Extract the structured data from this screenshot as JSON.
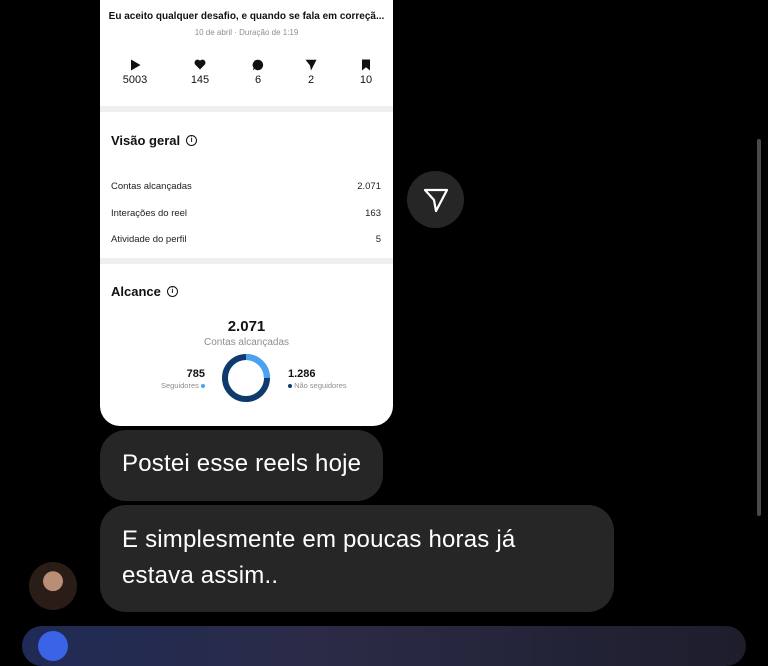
{
  "post": {
    "caption": "Eu aceito qualquer desafio, e quando se fala em correçã...",
    "meta": "10 de abril · Duração de 1:19",
    "stats": [
      {
        "icon": "play-icon",
        "value": "5003"
      },
      {
        "icon": "heart-icon",
        "value": "145"
      },
      {
        "icon": "comment-icon",
        "value": "6"
      },
      {
        "icon": "share-icon",
        "value": "2"
      },
      {
        "icon": "bookmark-icon",
        "value": "10"
      }
    ]
  },
  "overview": {
    "title": "Visão geral",
    "rows": [
      {
        "label": "Contas alcançadas",
        "value": "2.071"
      },
      {
        "label": "Interações do reel",
        "value": "163"
      },
      {
        "label": "Atividade do perfil",
        "value": "5"
      }
    ]
  },
  "reach": {
    "title": "Alcance",
    "total": "2.071",
    "total_label": "Contas alcançadas",
    "followers": {
      "value": "785",
      "label": "Seguidores",
      "color": "#4aa3f0",
      "fraction": 0.379
    },
    "non_followers": {
      "value": "1.286",
      "label": "Não seguidores",
      "color": "#0d3b6e",
      "fraction": 0.621
    }
  },
  "messages": [
    {
      "text": "Postei esse reels hoje"
    },
    {
      "text_line1": "E simplesmente em poucas horas já",
      "text_line2": "estava assim.."
    }
  ],
  "colors": {
    "background": "#000000",
    "bubble": "#262626",
    "card": "#ffffff"
  }
}
